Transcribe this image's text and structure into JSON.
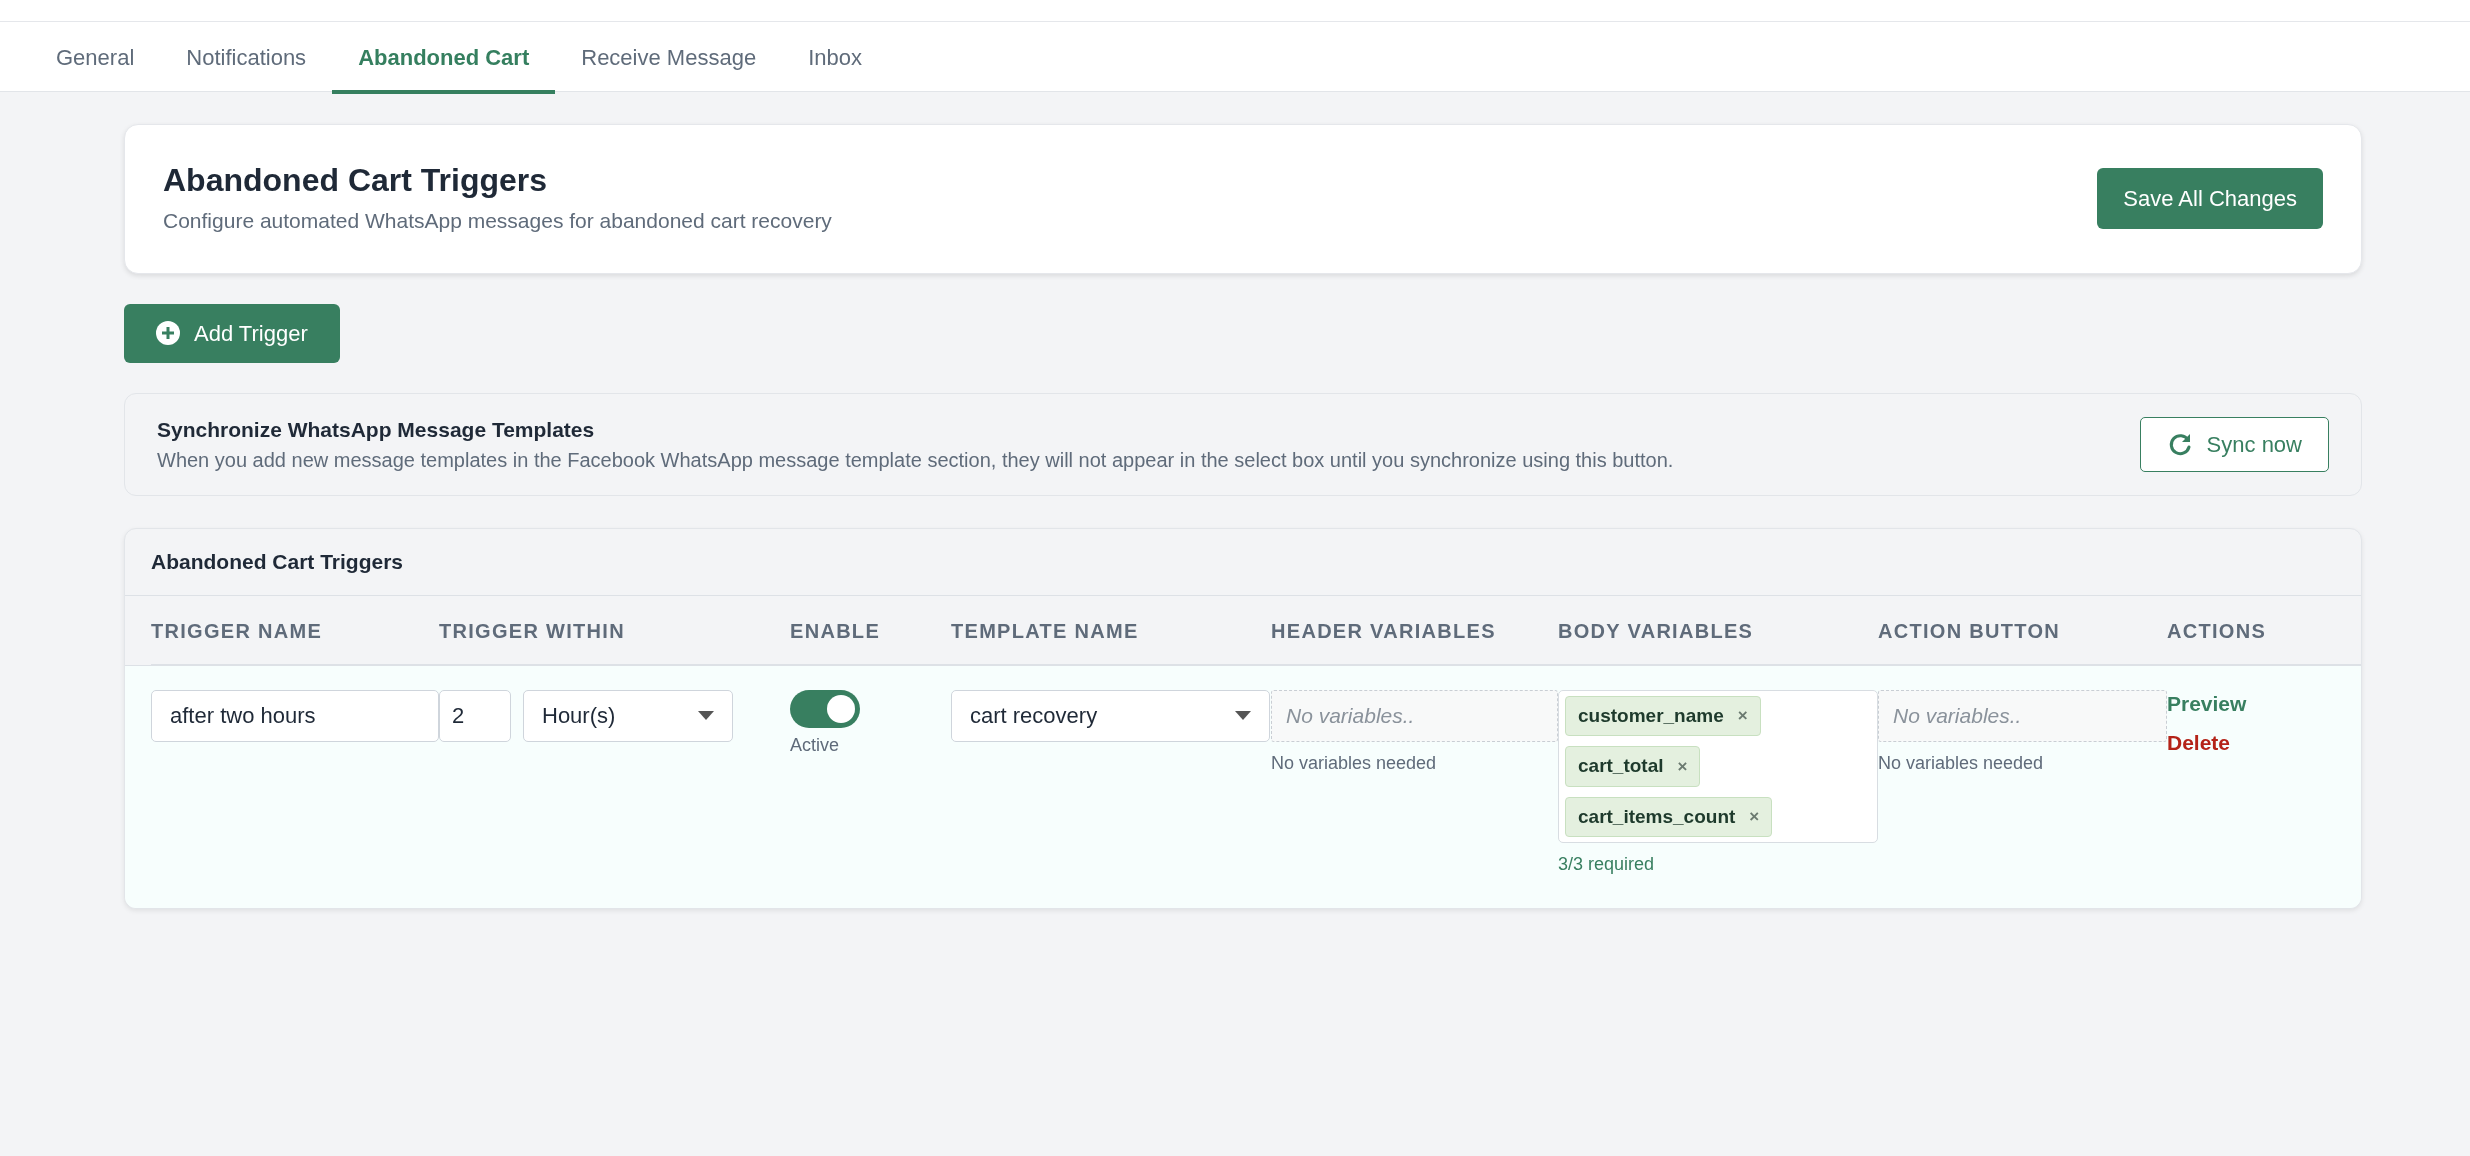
{
  "tabs": [
    {
      "label": "General",
      "selected": false
    },
    {
      "label": "Notifications",
      "selected": false
    },
    {
      "label": "Abandoned Cart",
      "selected": true
    },
    {
      "label": "Receive Message",
      "selected": false
    },
    {
      "label": "Inbox",
      "selected": false
    }
  ],
  "header": {
    "title": "Abandoned Cart Triggers",
    "subtitle": "Configure automated WhatsApp messages for abandoned cart recovery",
    "save_button": "Save All Changes"
  },
  "add_button": "Add Trigger",
  "sync": {
    "title": "Synchronize WhatsApp Message Templates",
    "description": "When you add new message templates in the Facebook WhatsApp message template section, they will not appear in the select box until you synchronize using this button.",
    "button": "Sync now"
  },
  "triggers_table": {
    "title": "Abandoned Cart Triggers",
    "columns": [
      "TRIGGER NAME",
      "TRIGGER WITHIN",
      "ENABLE",
      "TEMPLATE NAME",
      "HEADER VARIABLES",
      "BODY VARIABLES",
      "ACTION BUTTON",
      "ACTIONS"
    ],
    "rows": [
      {
        "name": "after two hours",
        "within_value": "2",
        "within_unit": "Hour(s)",
        "enabled": true,
        "enable_label": "Active",
        "template": "cart recovery",
        "header_variables": {
          "placeholder": "No variables..",
          "note": "No variables needed"
        },
        "body_variables": {
          "tags": [
            {
              "label": "customer_name",
              "remove": "×"
            },
            {
              "label": "cart_total",
              "remove": "×"
            },
            {
              "label": "cart_items_count",
              "remove": "×"
            }
          ],
          "note": "3/3 required"
        },
        "action_button": {
          "placeholder": "No variables..",
          "note": "No variables needed"
        },
        "actions": [
          {
            "label": "Preview",
            "kind": "preview"
          },
          {
            "label": "Delete",
            "kind": "delete"
          }
        ]
      }
    ]
  }
}
